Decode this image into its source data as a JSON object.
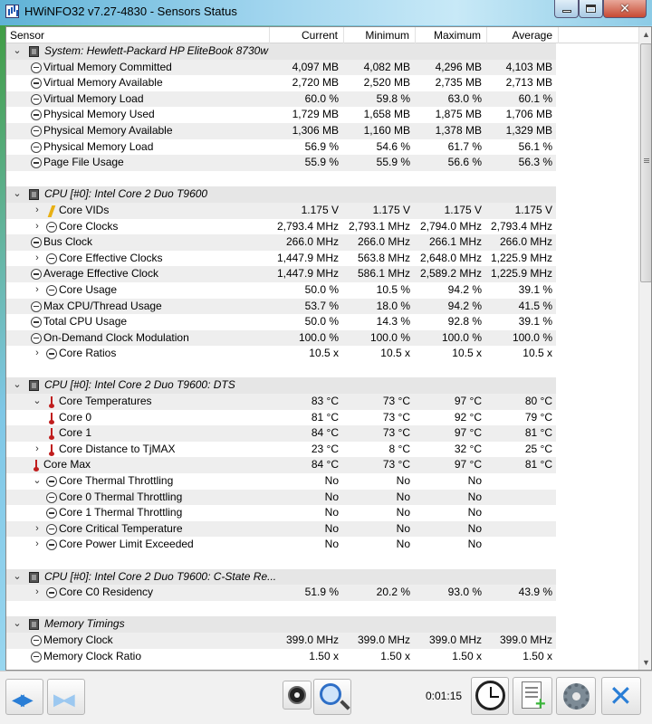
{
  "window": {
    "title": "HWiNFO32 v7.27-4830 - Sensors Status"
  },
  "columns": {
    "sensor": "Sensor",
    "current": "Current",
    "minimum": "Minimum",
    "maximum": "Maximum",
    "average": "Average"
  },
  "rows": [
    {
      "type": "group",
      "label": "System: Hewlett-Packard HP EliteBook 8730w",
      "arrow": "⌄",
      "icon": "chip"
    },
    {
      "type": "item",
      "label": "Virtual Memory Committed",
      "icon": "gauge",
      "indent": 0,
      "cur": "4,097 MB",
      "min": "4,082 MB",
      "max": "4,296 MB",
      "avg": "4,103 MB"
    },
    {
      "type": "item",
      "label": "Virtual Memory Available",
      "icon": "gauge",
      "indent": 0,
      "cur": "2,720 MB",
      "min": "2,520 MB",
      "max": "2,735 MB",
      "avg": "2,713 MB"
    },
    {
      "type": "item",
      "label": "Virtual Memory Load",
      "icon": "gauge",
      "indent": 0,
      "cur": "60.0 %",
      "min": "59.8 %",
      "max": "63.0 %",
      "avg": "60.1 %"
    },
    {
      "type": "item",
      "label": "Physical Memory Used",
      "icon": "gauge",
      "indent": 0,
      "cur": "1,729 MB",
      "min": "1,658 MB",
      "max": "1,875 MB",
      "avg": "1,706 MB"
    },
    {
      "type": "item",
      "label": "Physical Memory Available",
      "icon": "gauge",
      "indent": 0,
      "cur": "1,306 MB",
      "min": "1,160 MB",
      "max": "1,378 MB",
      "avg": "1,329 MB"
    },
    {
      "type": "item",
      "label": "Physical Memory Load",
      "icon": "gauge",
      "indent": 0,
      "cur": "56.9 %",
      "min": "54.6 %",
      "max": "61.7 %",
      "avg": "56.1 %"
    },
    {
      "type": "item",
      "label": "Page File Usage",
      "icon": "gauge",
      "indent": 0,
      "cur": "55.9 %",
      "min": "55.9 %",
      "max": "56.6 %",
      "avg": "56.3 %"
    },
    {
      "type": "spacer"
    },
    {
      "type": "group",
      "label": "CPU [#0]: Intel Core 2 Duo T9600",
      "arrow": "⌄",
      "icon": "chip"
    },
    {
      "type": "item",
      "label": "Core VIDs",
      "icon": "bolt",
      "indent": 1,
      "arrow": "›",
      "cur": "1.175 V",
      "min": "1.175 V",
      "max": "1.175 V",
      "avg": "1.175 V"
    },
    {
      "type": "item",
      "label": "Core Clocks",
      "icon": "gauge",
      "indent": 1,
      "arrow": "›",
      "cur": "2,793.4 MHz",
      "min": "2,793.1 MHz",
      "max": "2,794.0 MHz",
      "avg": "2,793.4 MHz"
    },
    {
      "type": "item",
      "label": "Bus Clock",
      "icon": "gauge",
      "indent": 0,
      "cur": "266.0 MHz",
      "min": "266.0 MHz",
      "max": "266.1 MHz",
      "avg": "266.0 MHz"
    },
    {
      "type": "item",
      "label": "Core Effective Clocks",
      "icon": "gauge",
      "indent": 1,
      "arrow": "›",
      "cur": "1,447.9 MHz",
      "min": "563.8 MHz",
      "max": "2,648.0 MHz",
      "avg": "1,225.9 MHz"
    },
    {
      "type": "item",
      "label": "Average Effective Clock",
      "icon": "gauge",
      "indent": 0,
      "cur": "1,447.9 MHz",
      "min": "586.1 MHz",
      "max": "2,589.2 MHz",
      "avg": "1,225.9 MHz"
    },
    {
      "type": "item",
      "label": "Core Usage",
      "icon": "gauge",
      "indent": 1,
      "arrow": "›",
      "cur": "50.0 %",
      "min": "10.5 %",
      "max": "94.2 %",
      "avg": "39.1 %"
    },
    {
      "type": "item",
      "label": "Max CPU/Thread Usage",
      "icon": "gauge",
      "indent": 0,
      "cur": "53.7 %",
      "min": "18.0 %",
      "max": "94.2 %",
      "avg": "41.5 %"
    },
    {
      "type": "item",
      "label": "Total CPU Usage",
      "icon": "gauge",
      "indent": 0,
      "cur": "50.0 %",
      "min": "14.3 %",
      "max": "92.8 %",
      "avg": "39.1 %"
    },
    {
      "type": "item",
      "label": "On-Demand Clock Modulation",
      "icon": "gauge",
      "indent": 0,
      "cur": "100.0 %",
      "min": "100.0 %",
      "max": "100.0 %",
      "avg": "100.0 %"
    },
    {
      "type": "item",
      "label": "Core Ratios",
      "icon": "gauge",
      "indent": 1,
      "arrow": "›",
      "cur": "10.5 x",
      "min": "10.5 x",
      "max": "10.5 x",
      "avg": "10.5 x"
    },
    {
      "type": "spacer"
    },
    {
      "type": "group",
      "label": "CPU [#0]: Intel Core 2 Duo T9600: DTS",
      "arrow": "⌄",
      "icon": "chip"
    },
    {
      "type": "item",
      "label": "Core Temperatures",
      "icon": "therm",
      "indent": 1,
      "arrow": "⌄",
      "cur": "83 °C",
      "min": "73 °C",
      "max": "97 °C",
      "avg": "80 °C"
    },
    {
      "type": "item",
      "label": "Core 0",
      "icon": "therm",
      "indent": 1,
      "cur": "81 °C",
      "min": "73 °C",
      "max": "92 °C",
      "avg": "79 °C"
    },
    {
      "type": "item",
      "label": "Core 1",
      "icon": "therm",
      "indent": 1,
      "cur": "84 °C",
      "min": "73 °C",
      "max": "97 °C",
      "avg": "81 °C"
    },
    {
      "type": "item",
      "label": "Core Distance to TjMAX",
      "icon": "therm",
      "indent": 1,
      "arrow": "›",
      "cur": "23 °C",
      "min": "8 °C",
      "max": "32 °C",
      "avg": "25 °C"
    },
    {
      "type": "item",
      "label": "Core Max",
      "icon": "therm",
      "indent": 0,
      "cur": "84 °C",
      "min": "73 °C",
      "max": "97 °C",
      "avg": "81 °C"
    },
    {
      "type": "item",
      "label": "Core Thermal Throttling",
      "icon": "gauge",
      "indent": 1,
      "arrow": "⌄",
      "cur": "No",
      "min": "No",
      "max": "No",
      "avg": ""
    },
    {
      "type": "item",
      "label": "Core 0 Thermal Throttling",
      "icon": "gauge",
      "indent": 1,
      "cur": "No",
      "min": "No",
      "max": "No",
      "avg": ""
    },
    {
      "type": "item",
      "label": "Core 1 Thermal Throttling",
      "icon": "gauge",
      "indent": 1,
      "cur": "No",
      "min": "No",
      "max": "No",
      "avg": ""
    },
    {
      "type": "item",
      "label": "Core Critical Temperature",
      "icon": "gauge",
      "indent": 1,
      "arrow": "›",
      "cur": "No",
      "min": "No",
      "max": "No",
      "avg": ""
    },
    {
      "type": "item",
      "label": "Core Power Limit Exceeded",
      "icon": "gauge",
      "indent": 1,
      "arrow": "›",
      "cur": "No",
      "min": "No",
      "max": "No",
      "avg": ""
    },
    {
      "type": "spacer"
    },
    {
      "type": "group",
      "label": "CPU [#0]: Intel Core 2 Duo T9600: C-State Re...",
      "arrow": "⌄",
      "icon": "chip"
    },
    {
      "type": "item",
      "label": "Core C0 Residency",
      "icon": "gauge",
      "indent": 1,
      "arrow": "›",
      "cur": "51.9 %",
      "min": "20.2 %",
      "max": "93.0 %",
      "avg": "43.9 %"
    },
    {
      "type": "spacer"
    },
    {
      "type": "group",
      "label": "Memory Timings",
      "arrow": "⌄",
      "icon": "chip"
    },
    {
      "type": "item",
      "label": "Memory Clock",
      "icon": "gauge",
      "indent": 0,
      "cur": "399.0 MHz",
      "min": "399.0 MHz",
      "max": "399.0 MHz",
      "avg": "399.0 MHz"
    },
    {
      "type": "item",
      "label": "Memory Clock Ratio",
      "icon": "gauge",
      "indent": 0,
      "cur": "1.50 x",
      "min": "1.50 x",
      "max": "1.50 x",
      "avg": "1.50 x"
    }
  ],
  "toolbar": {
    "elapsed": "0:01:15"
  }
}
